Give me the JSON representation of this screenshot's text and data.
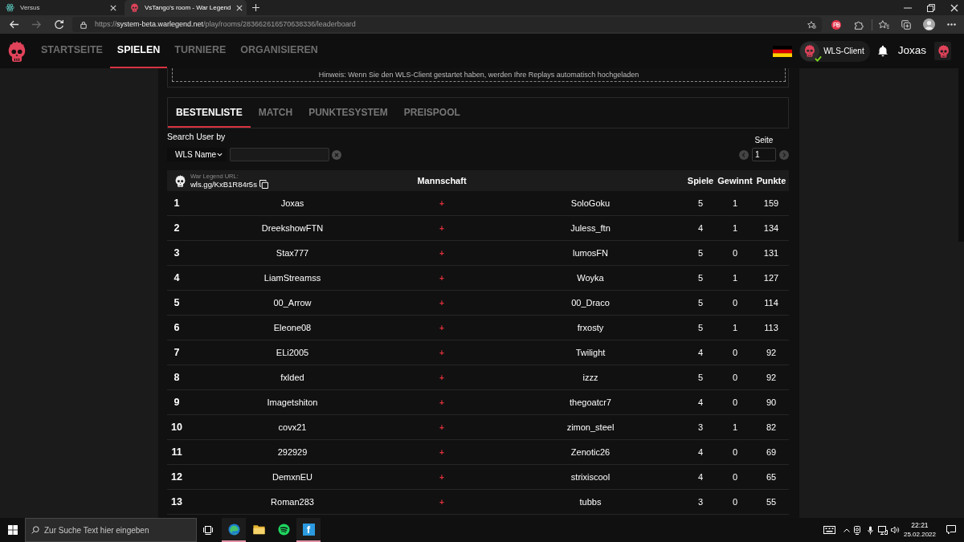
{
  "browser": {
    "tabs": [
      {
        "title": "Versus",
        "selected": false
      },
      {
        "title": "VsTango's room - War Legend",
        "selected": true
      }
    ],
    "nav_buttons": [
      {
        "kind": "back",
        "disabled": false
      },
      {
        "kind": "forward",
        "disabled": true
      },
      {
        "kind": "reload",
        "disabled": false
      }
    ],
    "address": {
      "scheme": "https://",
      "host": "system-beta.warlegend.net",
      "path": "/play/rooms/283662616570638336/leaderboard"
    }
  },
  "site_nav": {
    "items": [
      {
        "label": "STARTSEITE",
        "selected": false
      },
      {
        "label": "SPIELEN",
        "selected": true
      },
      {
        "label": "TURNIERE",
        "selected": false
      },
      {
        "label": "ORGANISIEREN",
        "selected": false
      }
    ],
    "client": {
      "label": "WLS-Client",
      "connected": true
    },
    "user": "Joxas"
  },
  "notice": "Hinweis: Wenn Sie den WLS-Client gestartet haben, werden Ihre Replays automatisch hochgeladen",
  "leaderboard": {
    "tabs": [
      {
        "label": "BESTENLISTE",
        "selected": true
      },
      {
        "label": "MATCH",
        "selected": false
      },
      {
        "label": "PUNKTESYSTEM",
        "selected": false
      },
      {
        "label": "PREISPOOL",
        "selected": false
      }
    ],
    "search": {
      "label": "Search User by",
      "field": "WLS Name"
    },
    "pager": {
      "label": "Seite",
      "page": "1"
    },
    "url_label": "War Legend URL:",
    "url": "wls.gg/KxB1R84r5s",
    "columns": [
      "Mannschaft",
      "Spiele",
      "Gewinnt",
      "Punkte"
    ],
    "rows": [
      {
        "rank": "1",
        "player_1": "Joxas",
        "joiner": "+",
        "player_2": "SoloGoku",
        "games": "5",
        "wins": "1",
        "points": "159"
      },
      {
        "rank": "2",
        "player_1": "DreekshowFTN",
        "joiner": "+",
        "player_2": "Juless_ftn",
        "games": "4",
        "wins": "1",
        "points": "134"
      },
      {
        "rank": "3",
        "player_1": "Stax777",
        "joiner": "+",
        "player_2": "lumosFN",
        "games": "5",
        "wins": "0",
        "points": "131"
      },
      {
        "rank": "4",
        "player_1": "LiamStreamss",
        "joiner": "+",
        "player_2": "Woyka",
        "games": "5",
        "wins": "1",
        "points": "127"
      },
      {
        "rank": "5",
        "player_1": "00_Arrow",
        "joiner": "+",
        "player_2": "00_Draco",
        "games": "5",
        "wins": "0",
        "points": "114"
      },
      {
        "rank": "6",
        "player_1": "Eleone08",
        "joiner": "+",
        "player_2": "frxosty",
        "games": "5",
        "wins": "1",
        "points": "113"
      },
      {
        "rank": "7",
        "player_1": "ELi2005",
        "joiner": "+",
        "player_2": "Twilight",
        "games": "4",
        "wins": "0",
        "points": "92"
      },
      {
        "rank": "8",
        "player_1": "fxlded",
        "joiner": "+",
        "player_2": "izzz",
        "games": "5",
        "wins": "0",
        "points": "92"
      },
      {
        "rank": "9",
        "player_1": "Imagetshiton",
        "joiner": "+",
        "player_2": "thegoatcr7",
        "games": "4",
        "wins": "0",
        "points": "90"
      },
      {
        "rank": "10",
        "player_1": "covx21",
        "joiner": "+",
        "player_2": "zimon_steel",
        "games": "3",
        "wins": "1",
        "points": "82"
      },
      {
        "rank": "11",
        "player_1": "292929",
        "joiner": "+",
        "player_2": "Zenotic26",
        "games": "4",
        "wins": "0",
        "points": "69"
      },
      {
        "rank": "12",
        "player_1": "DemxnEU",
        "joiner": "+",
        "player_2": "strixiscool",
        "games": "4",
        "wins": "0",
        "points": "65"
      },
      {
        "rank": "13",
        "player_1": "Roman283",
        "joiner": "+",
        "player_2": "tubbs",
        "games": "3",
        "wins": "0",
        "points": "55"
      }
    ]
  },
  "taskbar": {
    "search": {
      "placeholder": "Zur Suche Text hier eingeben"
    },
    "apps": [
      {
        "kind": "edge",
        "running": true
      },
      {
        "kind": "explorer",
        "running": false
      },
      {
        "kind": "spotify",
        "running": false
      },
      {
        "kind": "letter",
        "label": "f",
        "running": true
      }
    ],
    "time": "22:21",
    "date": "25.02.2022"
  }
}
